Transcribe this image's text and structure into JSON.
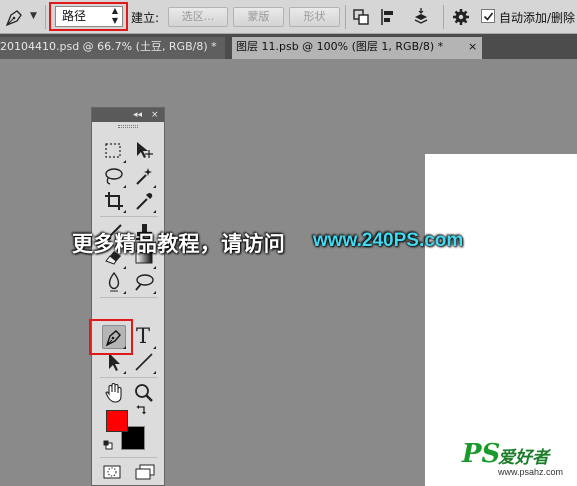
{
  "options_bar": {
    "tool_icon": "pen-icon",
    "mode_select_value": "路径",
    "build_label": "建立:",
    "selection_button": "选区...",
    "mask_button": "蒙版",
    "shape_button": "形状",
    "icons": [
      "path-operations-icon",
      "path-alignment-icon",
      "path-arrangement-icon",
      "gear-icon"
    ],
    "auto_add_delete_checked": true,
    "auto_add_delete_label": "自动添加/删除"
  },
  "tabs": [
    {
      "label": "20104410.psd @ 66.7% (土豆, RGB/8) *",
      "close": "×",
      "active": false
    },
    {
      "label": "图层 11.psb @ 100% (图层 1, RGB/8) *",
      "close": "×",
      "active": true
    }
  ],
  "tools_panel": {
    "collapse_glyph": "◂◂",
    "close_glyph": "×",
    "tools": [
      "rectangular-marquee-icon",
      "move-icon",
      "lasso-icon",
      "magic-wand-icon",
      "crop-icon",
      "eyedropper-icon",
      "brush-icon",
      "clone-stamp-icon",
      "eraser-icon",
      "gradient-icon",
      "blur-icon",
      "dodge-icon",
      "pen-icon",
      "type-icon",
      "path-selection-icon",
      "line-icon",
      "hand-icon",
      "zoom-icon"
    ],
    "type_tool_glyph": "T",
    "foreground_color": "#ff0000",
    "background_color": "#000000"
  },
  "overlay": {
    "text": "更多精品教程，请访问",
    "url": "www.240PS.com"
  },
  "watermark": {
    "logo": "PS",
    "name": "爱好者",
    "url": "www.psahz.com"
  },
  "colors": {
    "highlight": "#e0191a",
    "workspace": "#8a8a8a",
    "url_color": "#43d9f1"
  }
}
